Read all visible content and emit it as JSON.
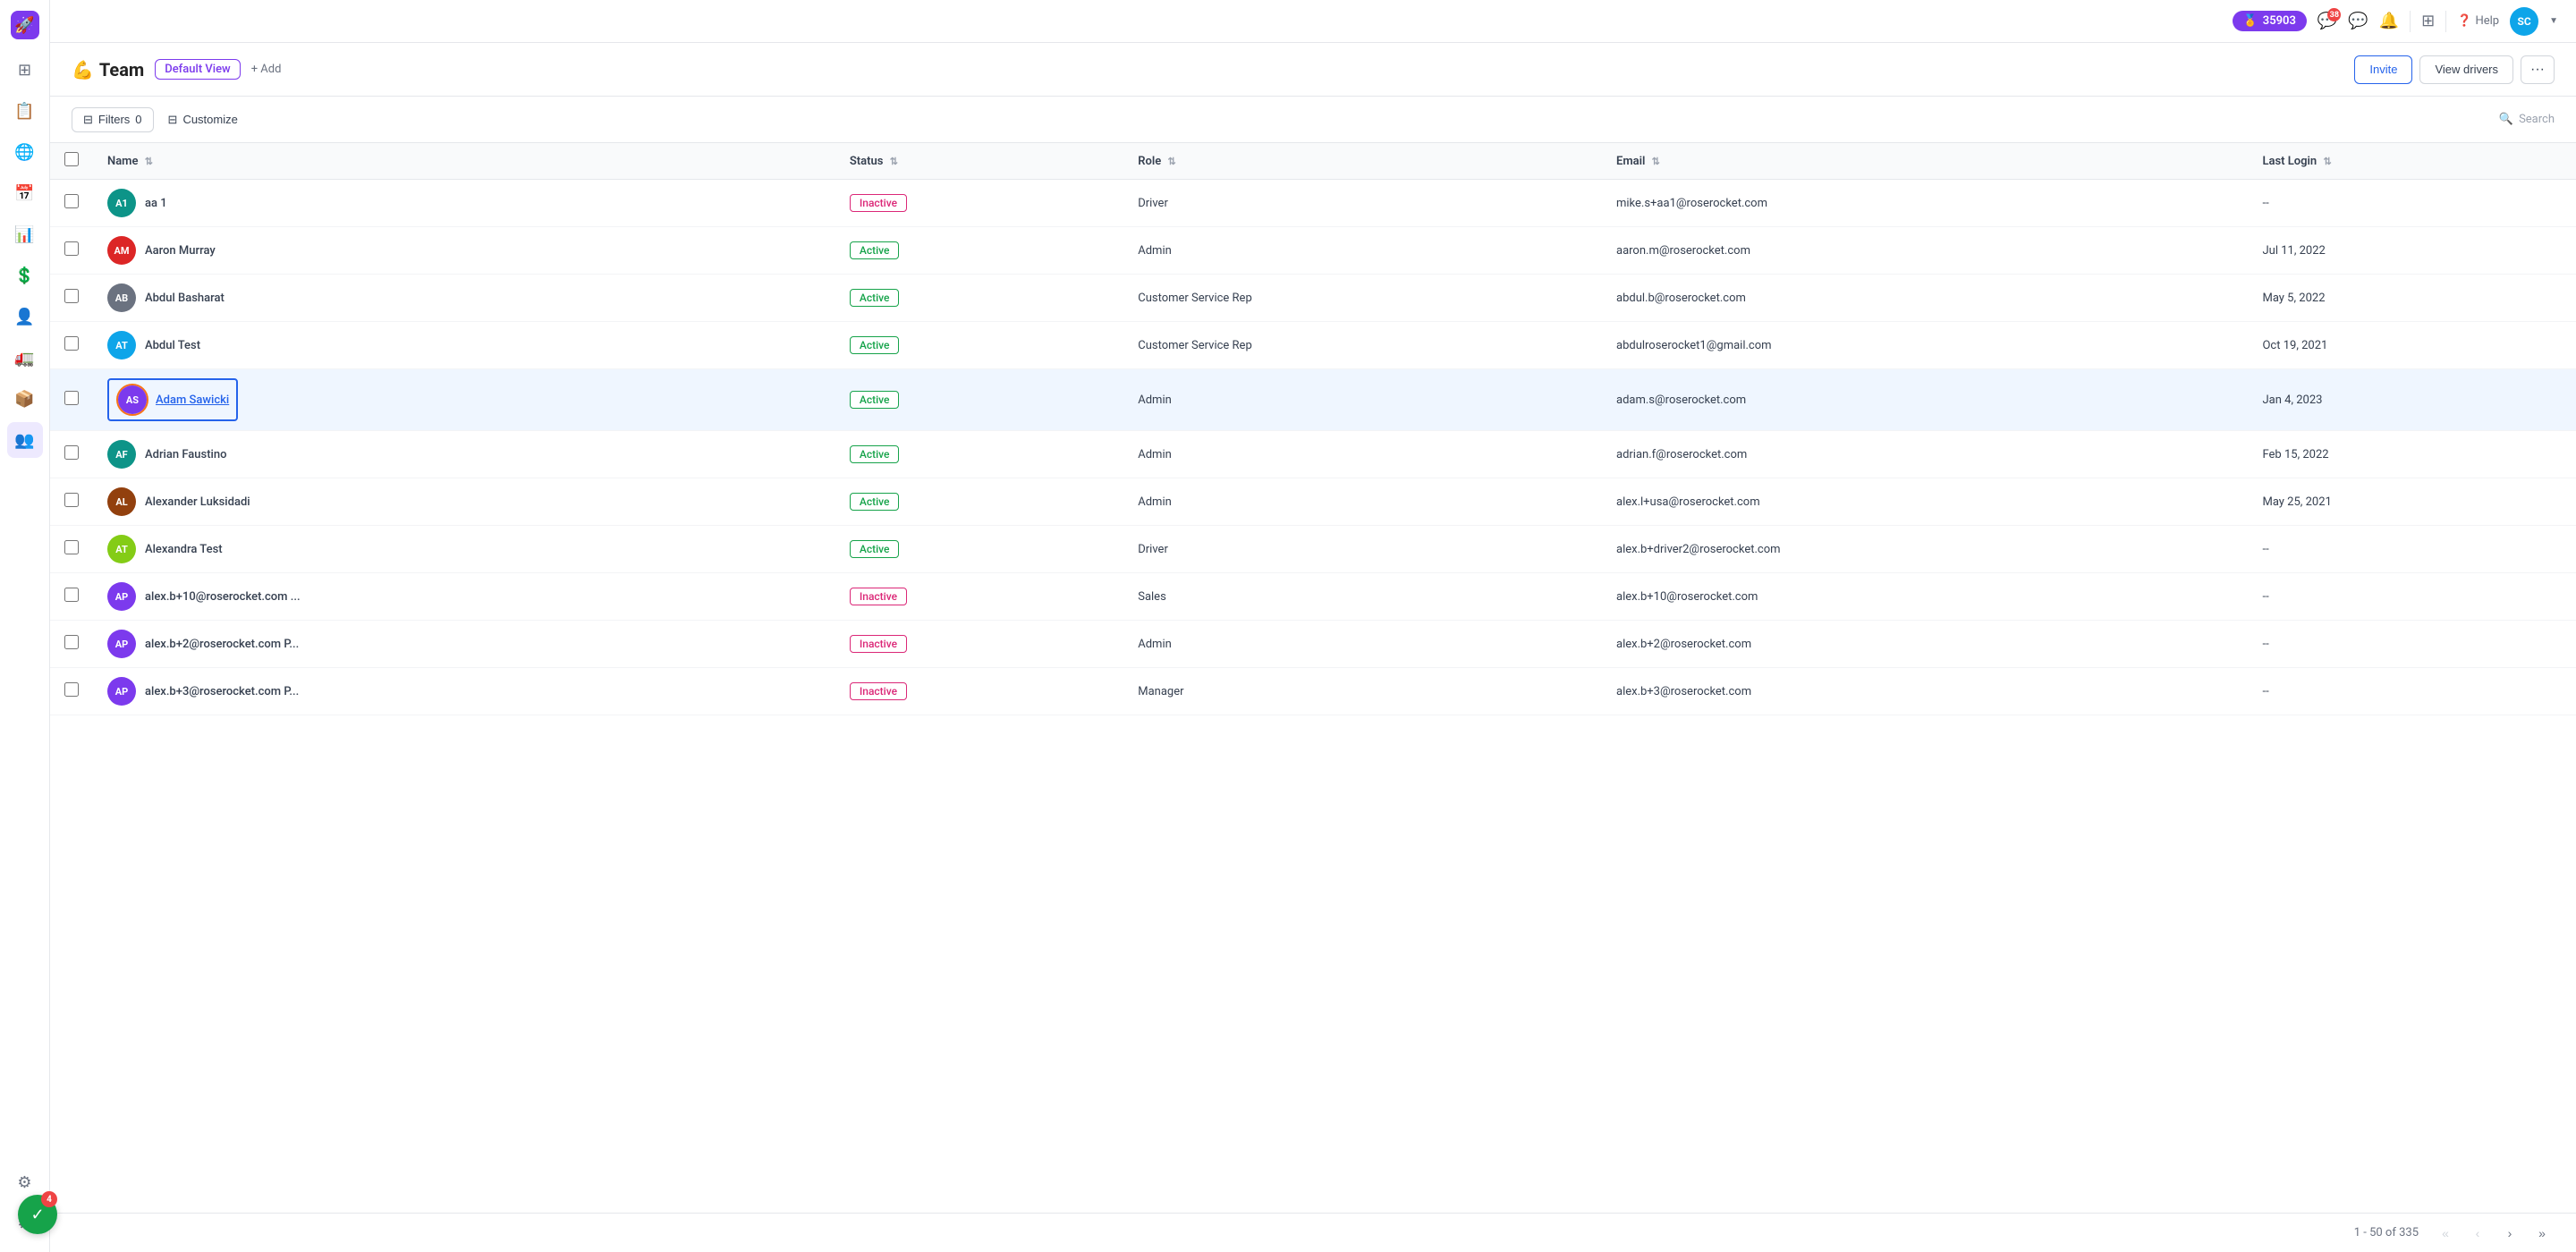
{
  "sidebar": {
    "logo": "🚀",
    "items": [
      {
        "id": "dashboard",
        "icon": "⊞",
        "active": false
      },
      {
        "id": "documents",
        "icon": "📄",
        "active": false
      },
      {
        "id": "globe",
        "icon": "🌐",
        "active": false
      },
      {
        "id": "calendar",
        "icon": "📅",
        "active": false
      },
      {
        "id": "chart",
        "icon": "📊",
        "active": false
      },
      {
        "id": "dollar",
        "icon": "💲",
        "active": false
      },
      {
        "id": "users-grid",
        "icon": "⊟",
        "active": false
      },
      {
        "id": "truck",
        "icon": "🚛",
        "active": false
      },
      {
        "id": "box",
        "icon": "📦",
        "active": false
      },
      {
        "id": "team",
        "icon": "👥",
        "active": true
      },
      {
        "id": "integrations",
        "icon": "⚙",
        "active": false
      },
      {
        "id": "settings",
        "icon": "⚙",
        "active": false
      }
    ]
  },
  "topbar": {
    "points": "35903",
    "points_icon": "🏅",
    "badge_count": "38",
    "help_label": "Help",
    "avatar_initials": "SC",
    "avatar_color": "#0ea5e9"
  },
  "page_header": {
    "title_icon": "💪",
    "title": "Team",
    "view_label": "Default View",
    "add_label": "+ Add",
    "invite_label": "Invite",
    "view_drivers_label": "View drivers",
    "more_label": "···"
  },
  "toolbar": {
    "filter_label": "Filters",
    "filter_count": "0",
    "customize_label": "Customize",
    "search_label": "Search"
  },
  "table": {
    "columns": [
      {
        "id": "name",
        "label": "Name"
      },
      {
        "id": "status",
        "label": "Status"
      },
      {
        "id": "role",
        "label": "Role"
      },
      {
        "id": "email",
        "label": "Email"
      },
      {
        "id": "last_login",
        "label": "Last Login"
      }
    ],
    "rows": [
      {
        "id": "aa1",
        "avatar_initials": "A1",
        "avatar_color": "#0d9488",
        "name": "aa 1",
        "status": "Inactive",
        "status_type": "inactive",
        "role": "Driver",
        "email": "mike.s+aa1@roserocket.com",
        "last_login": "--",
        "selected": false,
        "highlighted": false
      },
      {
        "id": "aaron-murray",
        "avatar_initials": "AM",
        "avatar_color": "#dc2626",
        "name": "Aaron Murray",
        "status": "Active",
        "status_type": "active",
        "role": "Admin",
        "email": "aaron.m@roserocket.com",
        "last_login": "Jul 11, 2022",
        "selected": false,
        "highlighted": false
      },
      {
        "id": "abdul-basharat",
        "avatar_initials": "AB",
        "avatar_color": "#6b7280",
        "name": "Abdul Basharat",
        "status": "Active",
        "status_type": "active",
        "role": "Customer Service Rep",
        "email": "abdul.b@roserocket.com",
        "last_login": "May 5, 2022",
        "selected": false,
        "highlighted": false
      },
      {
        "id": "abdul-test",
        "avatar_initials": "AT",
        "avatar_color": "#0ea5e9",
        "name": "Abdul Test",
        "status": "Active",
        "status_type": "active",
        "role": "Customer Service Rep",
        "email": "abdulroserocket1@gmail.com",
        "last_login": "Oct 19, 2021",
        "selected": false,
        "highlighted": false
      },
      {
        "id": "adam-sawicki",
        "avatar_initials": "AS",
        "avatar_color": "#7c3aed",
        "name": "Adam Sawicki",
        "status": "Active",
        "status_type": "active",
        "role": "Admin",
        "email": "adam.s@roserocket.com",
        "last_login": "Jan 4, 2023",
        "selected": true,
        "highlighted": true
      },
      {
        "id": "adrian-faustino",
        "avatar_initials": "AF",
        "avatar_color": "#0d9488",
        "name": "Adrian Faustino",
        "status": "Active",
        "status_type": "active",
        "role": "Admin",
        "email": "adrian.f@roserocket.com",
        "last_login": "Feb 15, 2022",
        "selected": false,
        "highlighted": false
      },
      {
        "id": "alexander-luksidadi",
        "avatar_initials": "AL",
        "avatar_color": "#92400e",
        "name": "Alexander Luksidadi",
        "status": "Active",
        "status_type": "active",
        "role": "Admin",
        "email": "alex.l+usa@roserocket.com",
        "last_login": "May 25, 2021",
        "selected": false,
        "highlighted": false
      },
      {
        "id": "alexandra-test",
        "avatar_initials": "AT",
        "avatar_color": "#84cc16",
        "name": "Alexandra Test",
        "status": "Active",
        "status_type": "active",
        "role": "Driver",
        "email": "alex.b+driver2@roserocket.com",
        "last_login": "--",
        "selected": false,
        "highlighted": false
      },
      {
        "id": "alex-b10",
        "avatar_initials": "AP",
        "avatar_color": "#7c3aed",
        "name": "alex.b+10@roserocket.com ...",
        "status": "Inactive",
        "status_type": "inactive",
        "role": "Sales",
        "email": "alex.b+10@roserocket.com",
        "last_login": "--",
        "selected": false,
        "highlighted": false
      },
      {
        "id": "alex-b2",
        "avatar_initials": "AP",
        "avatar_color": "#7c3aed",
        "name": "alex.b+2@roserocket.com P...",
        "status": "Inactive",
        "status_type": "inactive",
        "role": "Admin",
        "email": "alex.b+2@roserocket.com",
        "last_login": "--",
        "selected": false,
        "highlighted": false
      },
      {
        "id": "alex-b3",
        "avatar_initials": "AP",
        "avatar_color": "#7c3aed",
        "name": "alex.b+3@roserocket.com P...",
        "status": "Inactive",
        "status_type": "inactive",
        "role": "Manager",
        "email": "alex.b+3@roserocket.com",
        "last_login": "--",
        "selected": false,
        "highlighted": false
      }
    ]
  },
  "footer": {
    "pagination_info": "1 - 50 of 335"
  },
  "notification": {
    "count": "4",
    "icon": "✓"
  }
}
